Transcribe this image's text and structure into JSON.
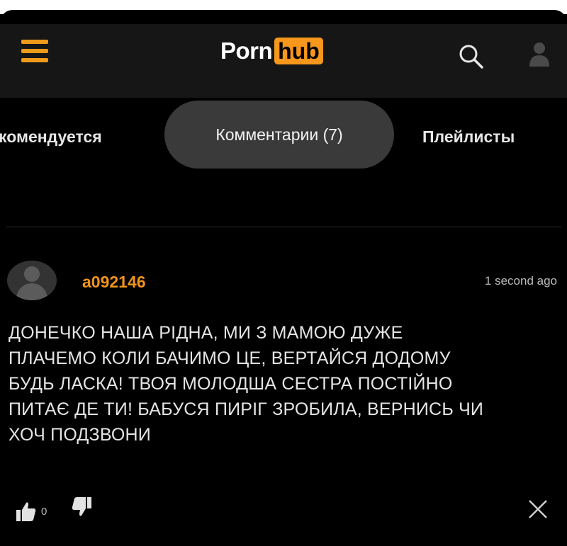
{
  "header": {
    "logo_left": "Porn",
    "logo_right": "hub"
  },
  "icons": {
    "menu": "hamburger-menu-icon",
    "search": "search-icon",
    "user": "user-icon",
    "like": "thumbs-up-icon",
    "dislike": "thumbs-down-icon",
    "close": "close-icon"
  },
  "tabs": [
    {
      "label": "комендуется"
    },
    {
      "label": "Комментарии (7)"
    },
    {
      "label": "Плейлисты"
    }
  ],
  "comment": {
    "username": "a092146",
    "timestamp": "1 second ago",
    "text_lines": [
      "ДОНЕЧКО НАША РІДНА, МИ З МАМОЮ ДУЖЕ",
      "ПЛАЧЕМО КОЛИ БАЧИМО ЦЕ, ВЕРТАЙСЯ ДОДОМУ",
      "БУДЬ ЛАСКА! ТВОЯ МОЛОДША СЕСТРА ПОСТІЙНО",
      "ПИТАЄ ДЕ ТИ! БАБУСЯ ПИРІГ ЗРОБИЛА, ВЕРНИСЬ ЧИ",
      "ХОЧ ПОДЗВОНИ"
    ],
    "likes": "0"
  },
  "colors": {
    "accent": "#f7971b",
    "background": "#000000",
    "header": "#161616",
    "active_tab": "#3a3a3a"
  }
}
